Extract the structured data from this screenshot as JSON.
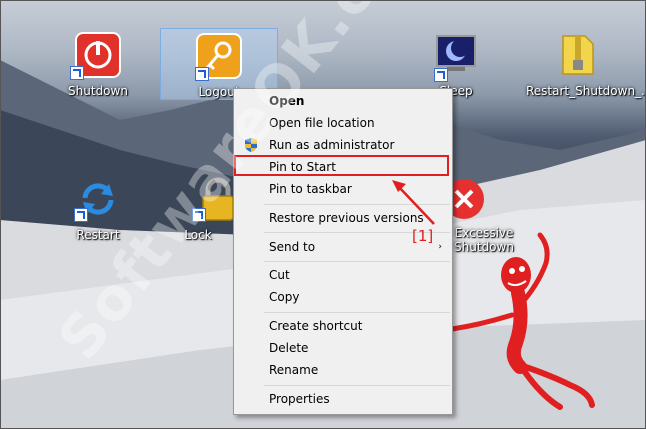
{
  "desktop": {
    "icons": [
      {
        "label": "Shutdown"
      },
      {
        "label": "Logout"
      },
      {
        "label": "Sleep"
      },
      {
        "label": "Restart_Shutdown_..."
      },
      {
        "label": "Restart"
      },
      {
        "label": "Lock"
      },
      {
        "label": "Excessive Shutdown"
      }
    ]
  },
  "context_menu": {
    "items": [
      {
        "label": "Open"
      },
      {
        "label": "Open file location"
      },
      {
        "label": "Run as administrator"
      },
      {
        "label": "Pin to Start"
      },
      {
        "label": "Pin to taskbar"
      },
      {
        "label": "Restore previous versions"
      },
      {
        "label": "Send to"
      },
      {
        "label": "Cut"
      },
      {
        "label": "Copy"
      },
      {
        "label": "Create shortcut"
      },
      {
        "label": "Delete"
      },
      {
        "label": "Rename"
      },
      {
        "label": "Properties"
      }
    ],
    "submenu_arrow": "›"
  },
  "annotation": {
    "callout": "[1]",
    "color": "#e02020"
  },
  "watermark": "SoftwareOK.com",
  "colors": {
    "menu_bg": "#f0f0f0",
    "highlight": "#e02020",
    "selection": "#b4d2f5"
  }
}
